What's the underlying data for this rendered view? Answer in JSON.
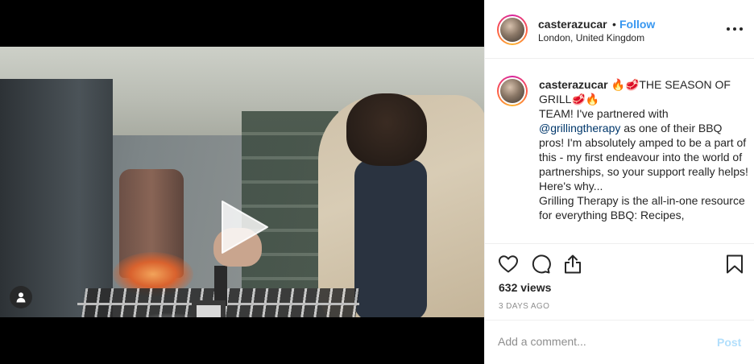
{
  "header": {
    "username": "casterazucar",
    "separator": "•",
    "follow_label": "Follow",
    "location": "London, United Kingdom",
    "more_icon": "more-horizontal-icon"
  },
  "caption": {
    "username": "casterazucar",
    "line1": "🔥🥩THE SEASON OF GRILL🥩🔥",
    "line2": "TEAM! I've partnered with",
    "mention": "@grillingtherapy",
    "line3": " as one of their BBQ pros! I'm absolutely amped to be a part of this - my first endeavour into the world of partnerships, so your support really helps!",
    "line4": "Here's why...",
    "line5": "Grilling Therapy is the all-in-one resource for everything BBQ: Recipes,"
  },
  "actions": {
    "like_icon": "heart-icon",
    "comment_icon": "comment-icon",
    "share_icon": "share-icon",
    "save_icon": "bookmark-icon",
    "views": "632 views",
    "age": "3 DAYS AGO"
  },
  "comment": {
    "placeholder": "Add a comment...",
    "post_label": "Post"
  },
  "media": {
    "play_icon": "play-icon",
    "tag_icon": "user-tag-icon"
  },
  "colors": {
    "accent": "#3897f0",
    "post_disabled": "#b2dffc",
    "muted": "#8e8e8e",
    "text": "#262626"
  }
}
